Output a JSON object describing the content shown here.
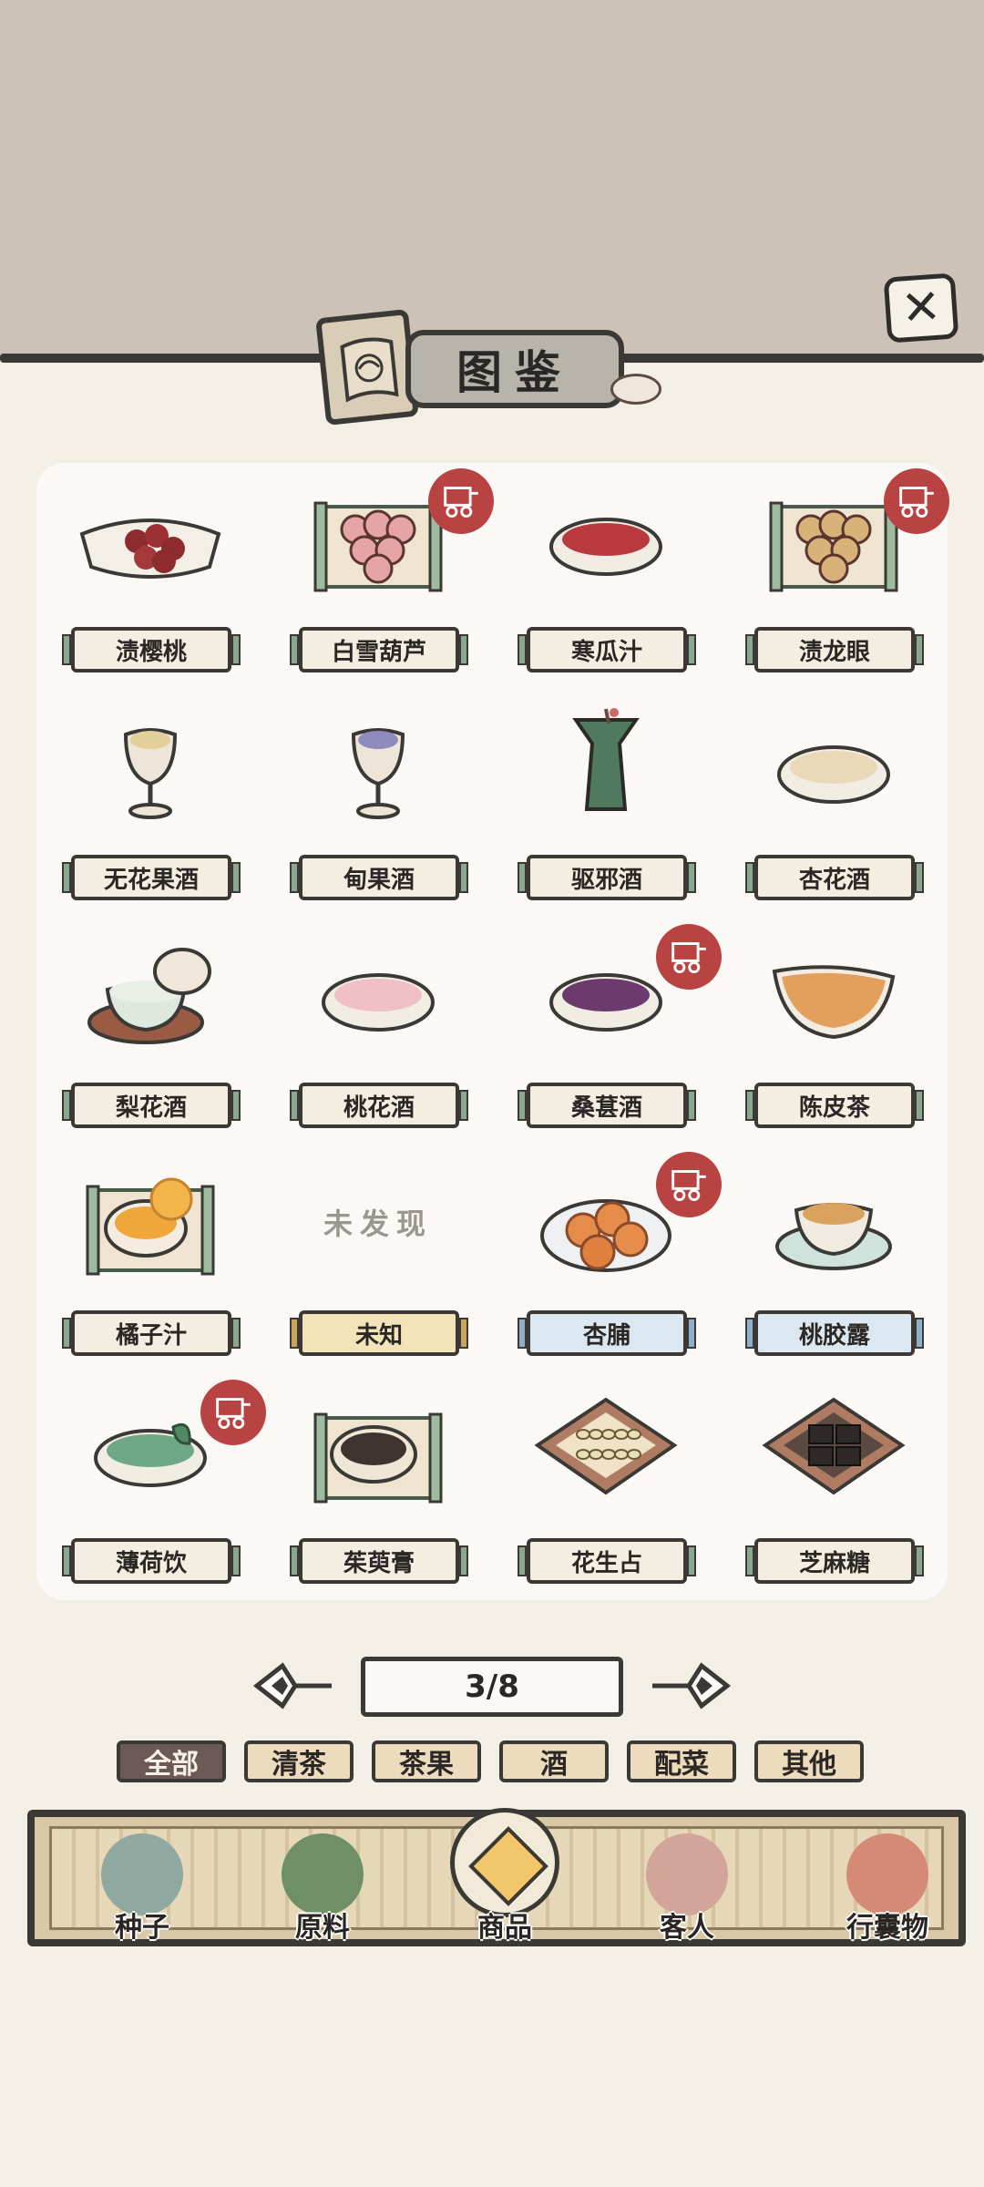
{
  "header": {
    "title": "图鉴",
    "close_icon": "close-icon",
    "title_icon": "book-icon"
  },
  "items": [
    {
      "name": "渍樱桃",
      "style": "green",
      "icon": "cherries-plate-icon",
      "cart_badge": false
    },
    {
      "name": "白雪葫芦",
      "style": "green",
      "icon": "hawthorn-tray-icon",
      "cart_badge": true
    },
    {
      "name": "寒瓜汁",
      "style": "green",
      "icon": "melon-juice-bowl-icon",
      "cart_badge": false
    },
    {
      "name": "渍龙眼",
      "style": "green",
      "icon": "longan-tray-icon",
      "cart_badge": true
    },
    {
      "name": "无花果酒",
      "style": "green",
      "icon": "fig-wine-cup-icon",
      "cart_badge": false
    },
    {
      "name": "甸果酒",
      "style": "green",
      "icon": "berry-wine-cup-icon",
      "cart_badge": false
    },
    {
      "name": "驱邪酒",
      "style": "green",
      "icon": "ritual-vessel-icon",
      "cart_badge": false
    },
    {
      "name": "杏花酒",
      "style": "green",
      "icon": "apricot-wine-bowl-icon",
      "cart_badge": false
    },
    {
      "name": "梨花酒",
      "style": "green",
      "icon": "teacup-lid-icon",
      "cart_badge": false
    },
    {
      "name": "桃花酒",
      "style": "green",
      "icon": "peach-wine-bowl-icon",
      "cart_badge": false
    },
    {
      "name": "桑葚酒",
      "style": "green",
      "icon": "mulberry-wine-bowl-icon",
      "cart_badge": true
    },
    {
      "name": "陈皮茶",
      "style": "green",
      "icon": "tea-pitcher-icon",
      "cart_badge": false
    },
    {
      "name": "橘子汁",
      "style": "green",
      "icon": "orange-juice-tray-icon",
      "cart_badge": false
    },
    {
      "name": "未知",
      "style": "gold",
      "icon": "",
      "cart_badge": false,
      "undiscovered": "未发现"
    },
    {
      "name": "杏脯",
      "style": "blue",
      "icon": "dried-apricot-plate-icon",
      "cart_badge": true
    },
    {
      "name": "桃胶露",
      "style": "blue",
      "icon": "peach-gum-cup-icon",
      "cart_badge": false
    },
    {
      "name": "薄荷饮",
      "style": "green",
      "icon": "mint-drink-bowl-icon",
      "cart_badge": true
    },
    {
      "name": "茱萸膏",
      "style": "green",
      "icon": "paste-bowl-tray-icon",
      "cart_badge": false
    },
    {
      "name": "花生占",
      "style": "green",
      "icon": "peanut-box-icon",
      "cart_badge": false
    },
    {
      "name": "芝麻糖",
      "style": "green",
      "icon": "sesame-candy-box-icon",
      "cart_badge": false
    }
  ],
  "pager": {
    "text": "3/8",
    "prev_icon": "arrow-left-icon",
    "next_icon": "arrow-right-icon"
  },
  "filters": [
    {
      "label": "全部",
      "active": true
    },
    {
      "label": "清茶",
      "active": false
    },
    {
      "label": "茶果",
      "active": false
    },
    {
      "label": "酒",
      "active": false
    },
    {
      "label": "配菜",
      "active": false
    },
    {
      "label": "其他",
      "active": false
    }
  ],
  "nav": [
    {
      "label": "种子",
      "icon": "seed-jar-icon",
      "active": false
    },
    {
      "label": "原料",
      "icon": "leaf-icon",
      "active": false
    },
    {
      "label": "商品",
      "icon": "goods-plate-icon",
      "active": true
    },
    {
      "label": "客人",
      "icon": "guest-girl-icon",
      "active": false
    },
    {
      "label": "行囊物",
      "icon": "robe-icon",
      "active": false
    }
  ],
  "colors": {
    "top_band": "#ccc2b7",
    "background": "#f3efe6",
    "panel": "#fbf9f5",
    "ink": "#3b3936",
    "cart_badge": "#b94343",
    "plate_green": "#8aa790",
    "plate_gold": "#c9a65c",
    "plate_blue": "#8fb0c8",
    "filter_active": "#6a5957"
  }
}
